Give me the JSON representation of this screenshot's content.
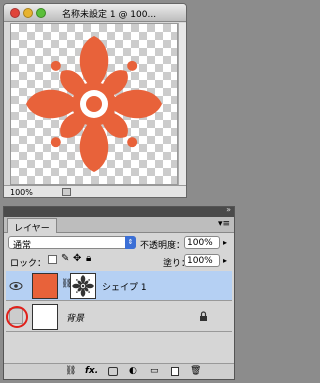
{
  "document": {
    "title": "名称未設定 1 @ 100...",
    "zoom": "100%",
    "shape_color": "#e8623a"
  },
  "layers_panel": {
    "tab_label": "レイヤー",
    "blend_mode": "通常",
    "opacity_label": "不透明度：",
    "opacity_value": "100%",
    "lock_label": "ロック：",
    "fill_label": "塗り：",
    "fill_value": "100%",
    "layers": [
      {
        "name": "シェイプ 1",
        "selected": true,
        "visible": true
      },
      {
        "name": "背景",
        "selected": false,
        "visible": false,
        "locked": true
      }
    ]
  },
  "icons": [
    "eye-icon",
    "link-icon",
    "lock-icon",
    "fx-icon",
    "mask-icon",
    "adjustment-icon",
    "folder-icon",
    "new-layer-icon",
    "trash-icon"
  ]
}
